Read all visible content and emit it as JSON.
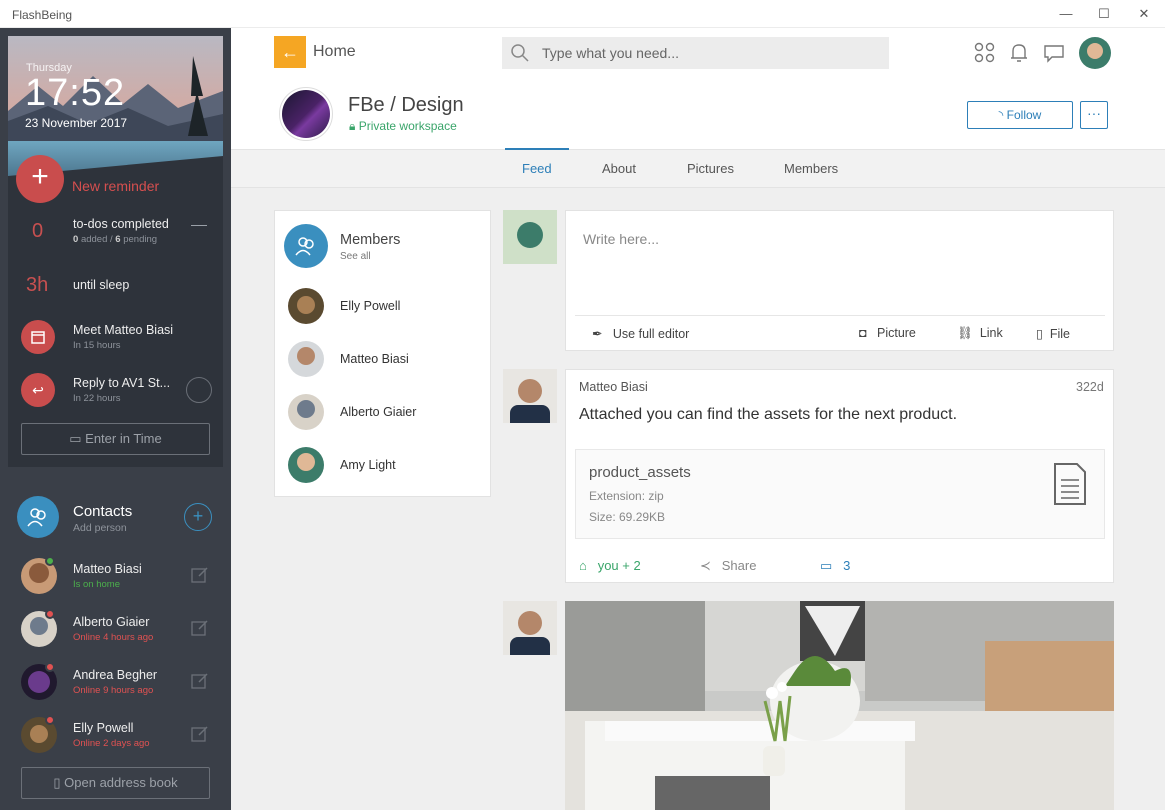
{
  "window": {
    "title": "FlashBeing",
    "minimize": "—",
    "maximize": "☐",
    "close": "✕"
  },
  "sidebar": {
    "hero": {
      "day": "Thursday",
      "time": "17:52",
      "date": "23 November 2017"
    },
    "new_reminder": "New reminder",
    "todos": {
      "count": "0",
      "title": "to-dos completed",
      "added": "0",
      "added_label": "added /",
      "pending": "6",
      "pending_label": "pending"
    },
    "sleep": {
      "value": "3h",
      "label": "until sleep"
    },
    "reminders": [
      {
        "title": "Meet Matteo Biasi",
        "sub": "In 15 hours"
      },
      {
        "title": "Reply to AV1 St...",
        "sub": "In 22 hours"
      }
    ],
    "enter_in_time": "Enter in Time",
    "contacts": {
      "title": "Contacts",
      "sub": "Add person"
    },
    "contact_list": [
      {
        "name": "Matteo Biasi",
        "status": "Is on home",
        "status_color": "#4cb04c"
      },
      {
        "name": "Alberto Giaier",
        "status": "Online 4 hours ago",
        "status_color": "#e05252"
      },
      {
        "name": "Andrea Begher",
        "status": "Online 9 hours ago",
        "status_color": "#e05252"
      },
      {
        "name": "Elly Powell",
        "status": "Online 2 days ago",
        "status_color": "#e05252"
      }
    ],
    "open_address_book": "Open address book"
  },
  "header": {
    "home": "Home",
    "search_placeholder": "Type what you need...",
    "workspace": {
      "name": "FBe / Design",
      "privacy": "Private workspace"
    },
    "follow": "Follow",
    "more": "···"
  },
  "tabs": [
    {
      "label": "Feed",
      "active": true
    },
    {
      "label": "About",
      "active": false
    },
    {
      "label": "Pictures",
      "active": false
    },
    {
      "label": "Members",
      "active": false
    }
  ],
  "members": {
    "title": "Members",
    "see_all": "See all",
    "list": [
      "Elly Powell",
      "Matteo Biasi",
      "Alberto Giaier",
      "Amy Light"
    ]
  },
  "compose": {
    "placeholder": "Write here...",
    "full_editor": "Use full editor",
    "picture": "Picture",
    "link": "Link",
    "file": "File"
  },
  "post": {
    "author": "Matteo Biasi",
    "age": "322d",
    "text": "Attached you can find the assets for the next product.",
    "file": {
      "name": "product_assets",
      "extension": "Extension: zip",
      "size": "Size: 69.29KB"
    },
    "likes": "you + 2",
    "share": "Share",
    "comments": "3"
  },
  "colors": {
    "accent": "#2d7fb8",
    "reminder": "#c94d4d",
    "home": "#f5a623",
    "private": "#3aa56a"
  }
}
